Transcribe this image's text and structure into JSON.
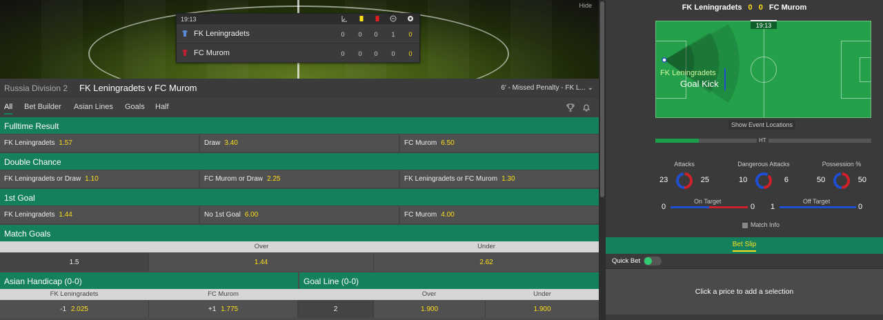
{
  "hero": {
    "hide_label": "Hide",
    "clock": "19:13",
    "teams": [
      {
        "name": "FK Leningradets",
        "stats": [
          "0",
          "0",
          "0",
          "1",
          "0"
        ]
      },
      {
        "name": "FC Murom",
        "stats": [
          "0",
          "0",
          "0",
          "0",
          "0"
        ]
      }
    ]
  },
  "header": {
    "competition": "Russia Division 2",
    "match": "FK Leningradets v FC Murom",
    "event_ticker": "6' - Missed Penalty - FK L..."
  },
  "tabs": [
    "All",
    "Bet Builder",
    "Asian Lines",
    "Goals",
    "Half"
  ],
  "markets": {
    "fulltime": {
      "title": "Fulltime Result",
      "selections": [
        {
          "name": "FK Leningradets",
          "odds": "1.57"
        },
        {
          "name": "Draw",
          "odds": "3.40"
        },
        {
          "name": "FC Murom",
          "odds": "6.50"
        }
      ]
    },
    "double_chance": {
      "title": "Double Chance",
      "selections": [
        {
          "name": "FK Leningradets or Draw",
          "odds": "1.10"
        },
        {
          "name": "FC Murom or Draw",
          "odds": "2.25"
        },
        {
          "name": "FK Leningradets or FC Murom",
          "odds": "1.30"
        }
      ]
    },
    "first_goal": {
      "title": "1st Goal",
      "selections": [
        {
          "name": "FK Leningradets",
          "odds": "1.44"
        },
        {
          "name": "No 1st Goal",
          "odds": "6.00"
        },
        {
          "name": "FC Murom",
          "odds": "4.00"
        }
      ]
    },
    "match_goals": {
      "title": "Match Goals",
      "columns": [
        "Over",
        "Under"
      ],
      "line": "1.5",
      "over": "1.44",
      "under": "2.62"
    },
    "asian_handicap": {
      "title": "Asian Handicap (0-0)",
      "columns": [
        "FK Leningradets",
        "FC Murom"
      ],
      "home_line": "-1",
      "home_odds": "2.025",
      "away_line": "+1",
      "away_odds": "1.775"
    },
    "goal_line": {
      "title": "Goal Line (0-0)",
      "columns": [
        "Over",
        "Under"
      ],
      "line": "2",
      "over": "1.900",
      "under": "1.900"
    }
  },
  "tracker": {
    "home": "FK Leningradets",
    "away": "FC Murom",
    "home_score": "0",
    "away_score": "0",
    "time": "19:13",
    "event_team": "FK Leningradets",
    "event": "Goal Kick",
    "show_events": "Show Event Locations",
    "ht_label": "HT",
    "progress_fraction": 0.2,
    "stats": [
      {
        "label": "Attacks",
        "home": "23",
        "away": "25"
      },
      {
        "label": "Dangerous Attacks",
        "home": "10",
        "away": "6"
      },
      {
        "label": "Possession %",
        "home": "50",
        "away": "50"
      }
    ],
    "on_target": {
      "label": "On Target",
      "home": "0",
      "away": "0"
    },
    "off_target": {
      "label": "Off Target",
      "home": "1",
      "away": "0"
    },
    "match_info": "Match Info"
  },
  "betslip": {
    "title": "Bet Slip",
    "quick_bet": "Quick Bet",
    "empty": "Click a price to add a selection"
  },
  "colors": {
    "green": "#14805e",
    "odds": "#ffdf1b",
    "home": "#1e4fd0",
    "away": "#d0202a"
  }
}
